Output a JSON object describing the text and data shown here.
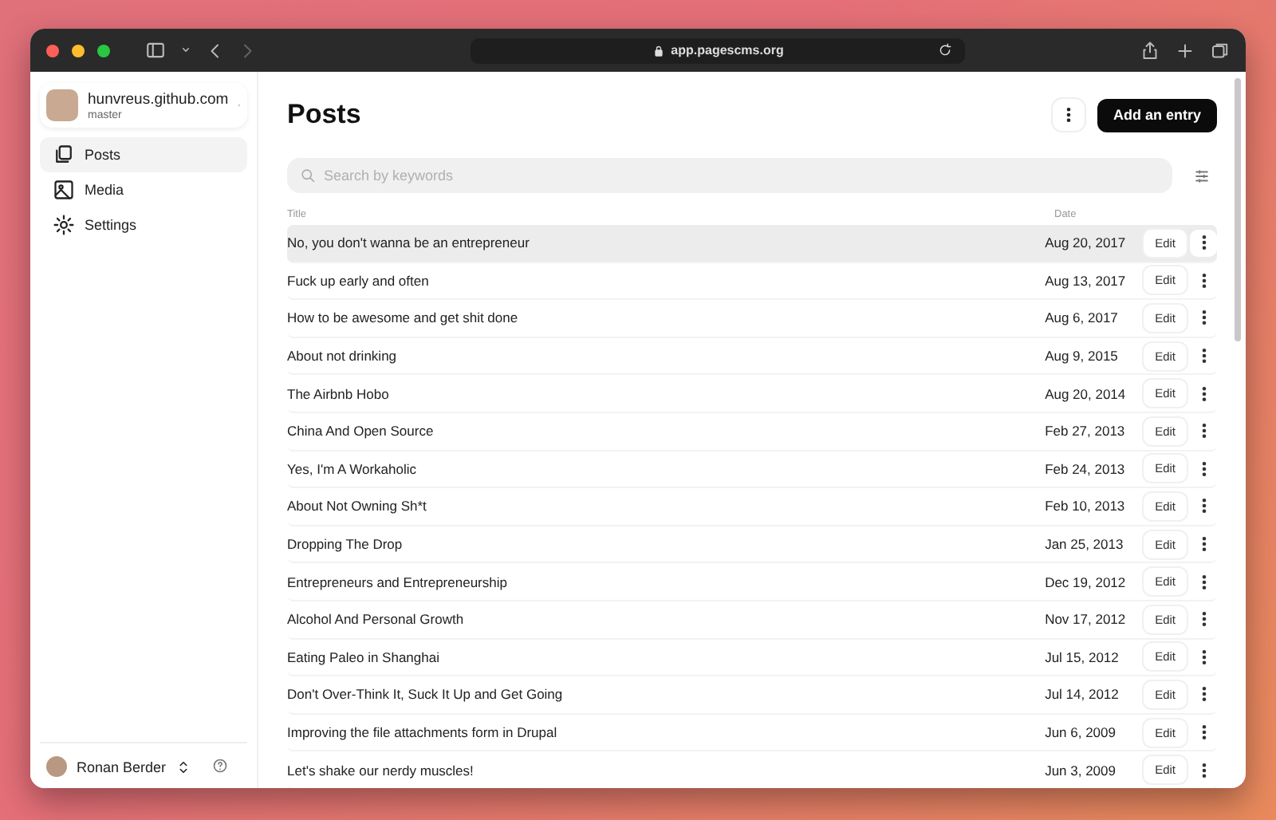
{
  "browser": {
    "url": "app.pagescms.org"
  },
  "sidebar": {
    "repo": {
      "name": "hunvreus.github.com",
      "branch": "master"
    },
    "items": [
      {
        "label": "Posts",
        "selected": true
      },
      {
        "label": "Media",
        "selected": false
      },
      {
        "label": "Settings",
        "selected": false
      }
    ],
    "user": {
      "name": "Ronan Berder"
    }
  },
  "page": {
    "title": "Posts",
    "add_button": "Add an entry",
    "search": {
      "placeholder": "Search by keywords"
    }
  },
  "table": {
    "columns": [
      "Title",
      "Date"
    ],
    "rows": [
      {
        "title": "No, you don't wanna be an entrepreneur",
        "date": "Aug 20, 2017",
        "edit": "Edit",
        "selected": true
      },
      {
        "title": "Fuck up early and often",
        "date": "Aug 13, 2017",
        "edit": "Edit",
        "selected": false
      },
      {
        "title": "How to be awesome and get shit done",
        "date": "Aug 6, 2017",
        "edit": "Edit",
        "selected": false
      },
      {
        "title": "About not drinking",
        "date": "Aug 9, 2015",
        "edit": "Edit",
        "selected": false
      },
      {
        "title": "The Airbnb Hobo",
        "date": "Aug 20, 2014",
        "edit": "Edit",
        "selected": false
      },
      {
        "title": "China And Open Source",
        "date": "Feb 27, 2013",
        "edit": "Edit",
        "selected": false
      },
      {
        "title": "Yes, I'm A Workaholic",
        "date": "Feb 24, 2013",
        "edit": "Edit",
        "selected": false
      },
      {
        "title": "About Not Owning Sh*t",
        "date": "Feb 10, 2013",
        "edit": "Edit",
        "selected": false
      },
      {
        "title": "Dropping The Drop",
        "date": "Jan 25, 2013",
        "edit": "Edit",
        "selected": false
      },
      {
        "title": "Entrepreneurs and Entrepreneurship",
        "date": "Dec 19, 2012",
        "edit": "Edit",
        "selected": false
      },
      {
        "title": "Alcohol And Personal Growth",
        "date": "Nov 17, 2012",
        "edit": "Edit",
        "selected": false
      },
      {
        "title": "Eating Paleo in Shanghai",
        "date": "Jul 15, 2012",
        "edit": "Edit",
        "selected": false
      },
      {
        "title": "Don't Over-Think It, Suck It Up and Get Going",
        "date": "Jul 14, 2012",
        "edit": "Edit",
        "selected": false
      },
      {
        "title": "Improving the file attachments form in Drupal",
        "date": "Jun 6, 2009",
        "edit": "Edit",
        "selected": false
      },
      {
        "title": "Let's shake our nerdy muscles!",
        "date": "Jun 3, 2009",
        "edit": "Edit",
        "selected": false
      }
    ]
  }
}
